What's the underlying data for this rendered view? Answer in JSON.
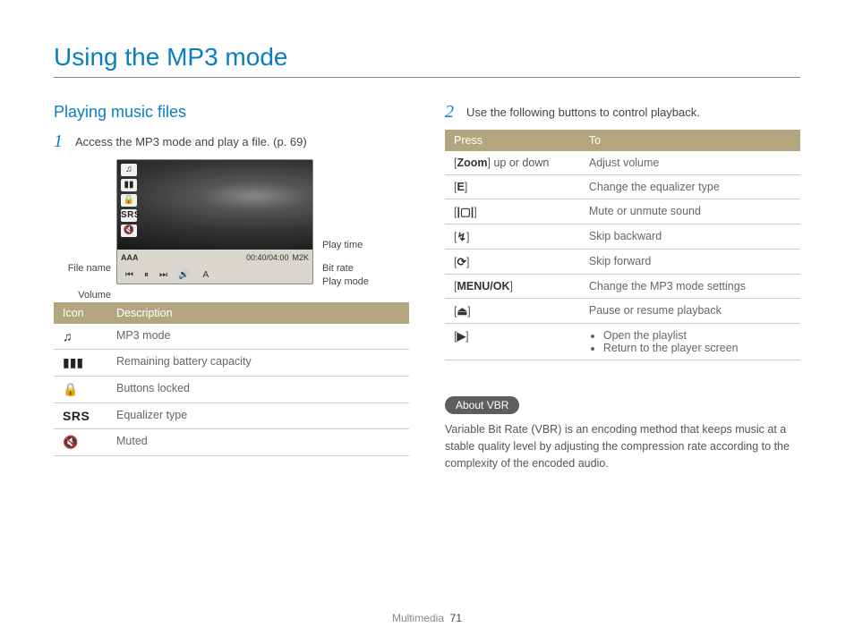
{
  "page_title": "Using the MP3 mode",
  "left": {
    "subheading": "Playing music files",
    "step1_num": "1",
    "step1_text": "Access the MP3 mode and play a file. (p. 69)",
    "screenshot": {
      "filename": "AAA",
      "playtime": "00:40/04:00",
      "bitrate": "M2K",
      "playmode": "A",
      "labels": {
        "play_time": "Play time",
        "bit_rate": "Bit rate",
        "play_mode": "Play mode",
        "file_name": "File name",
        "volume": "Volume"
      }
    },
    "icon_table": {
      "headers": {
        "icon": "Icon",
        "desc": "Description"
      },
      "rows": [
        {
          "icon": "♫",
          "desc": "MP3 mode"
        },
        {
          "icon": "▮▮▮",
          "desc": "Remaining battery capacity"
        },
        {
          "icon": "🔒",
          "desc": "Buttons locked"
        },
        {
          "icon": "SRS",
          "desc": "Equalizer type"
        },
        {
          "icon": "🔇",
          "desc": "Muted"
        }
      ]
    }
  },
  "right": {
    "step2_num": "2",
    "step2_text": "Use the following buttons to control playback.",
    "control_table": {
      "headers": {
        "press": "Press",
        "to": "To"
      },
      "rows": [
        {
          "press_prefix": "[",
          "press_strong": "Zoom",
          "press_suffix": "] up or down",
          "to": "Adjust volume"
        },
        {
          "press_prefix": "[",
          "press_strong": "E",
          "press_suffix": "]",
          "to": "Change the equalizer type"
        },
        {
          "press_prefix": "[",
          "press_strong": "|▢|",
          "press_suffix": "]",
          "to": "Mute or unmute sound"
        },
        {
          "press_prefix": "[",
          "press_strong": "↯",
          "press_suffix": "]",
          "to": "Skip backward"
        },
        {
          "press_prefix": "[",
          "press_strong": "⟳",
          "press_suffix": "]",
          "to": "Skip forward"
        },
        {
          "press_prefix": "[",
          "press_strong": "MENU/OK",
          "press_suffix": "]",
          "to": "Change the MP3 mode settings"
        },
        {
          "press_prefix": "[",
          "press_strong": "⏏",
          "press_suffix": "]",
          "to": "Pause or resume playback"
        },
        {
          "press_prefix": "[",
          "press_strong": "▶",
          "press_suffix": "]",
          "to_list": [
            "Open the playlist",
            "Return to the player screen"
          ]
        }
      ]
    },
    "about_pill": "About VBR",
    "about_text": "Variable Bit Rate (VBR) is an encoding method that keeps music at a stable quality level by adjusting the compression rate according to the complexity of the encoded audio."
  },
  "footer": {
    "section": "Multimedia",
    "page": "71"
  }
}
